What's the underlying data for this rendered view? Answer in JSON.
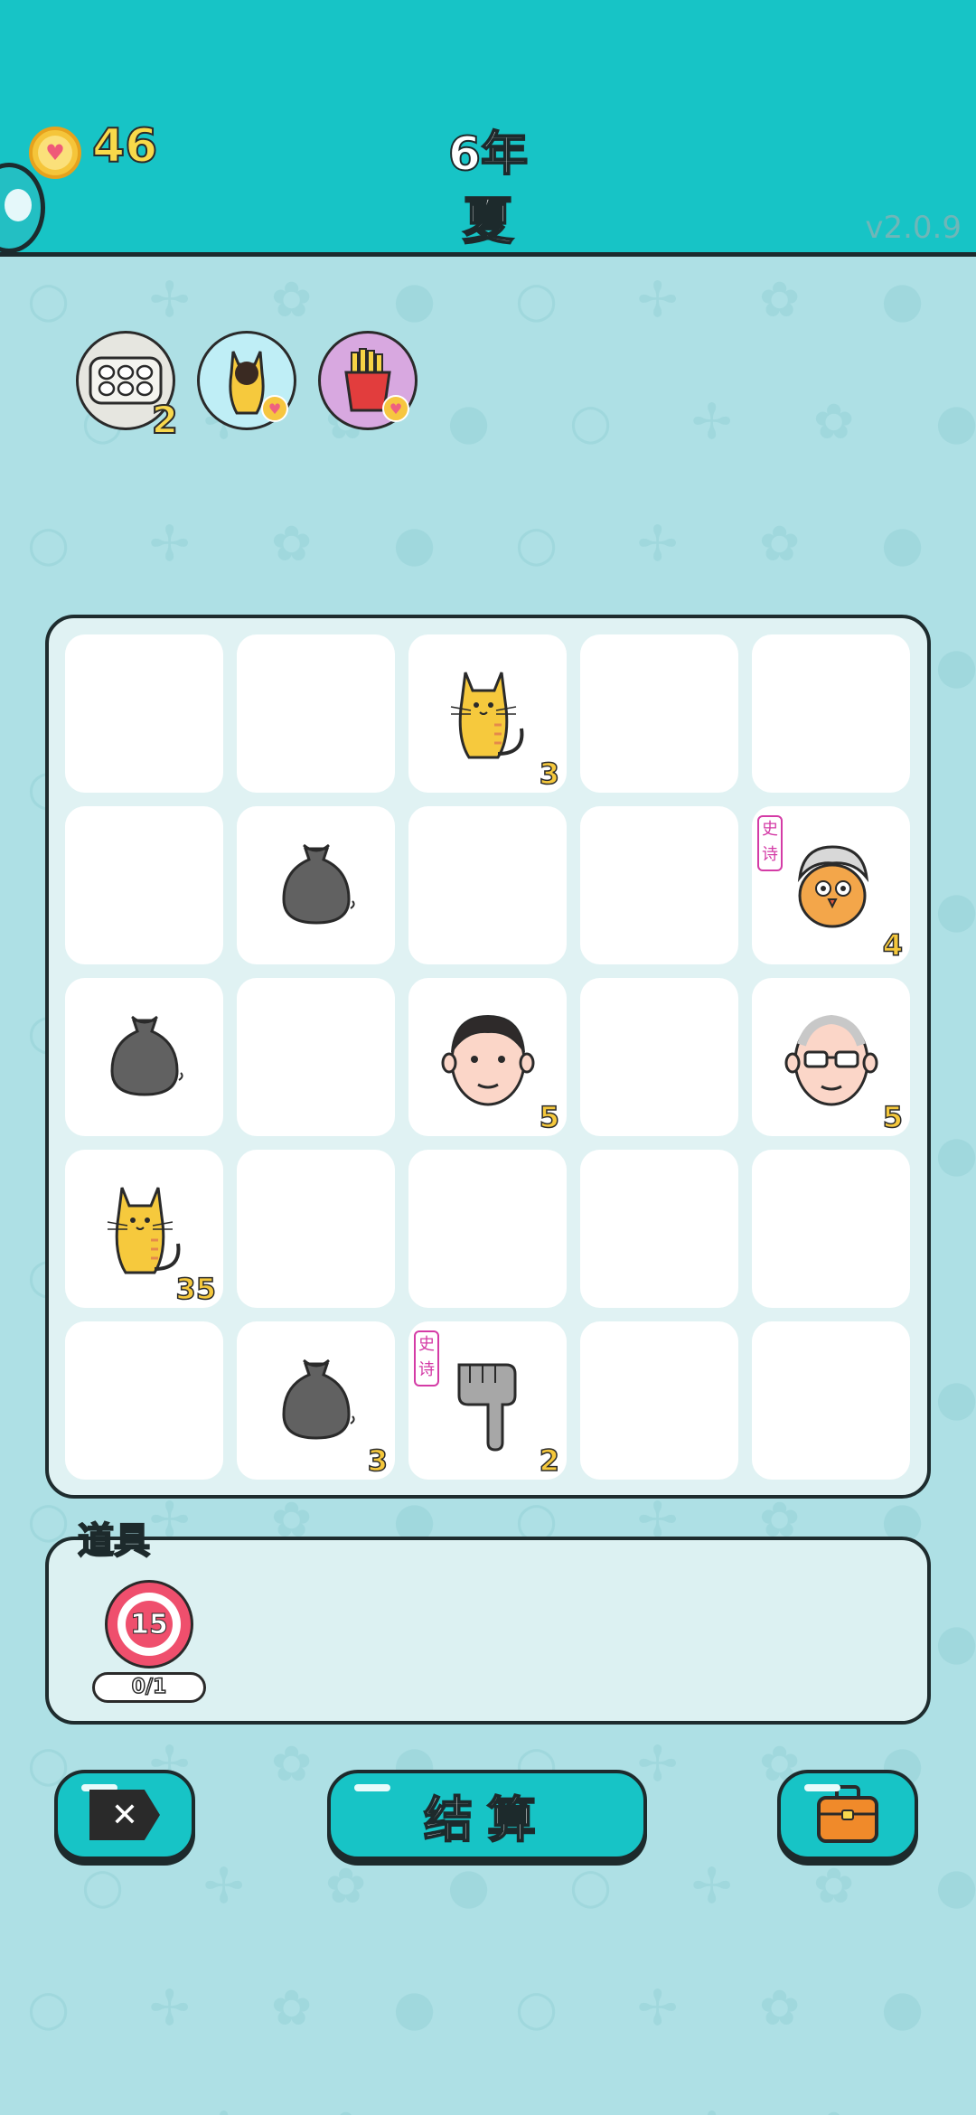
{
  "header": {
    "coins": "46",
    "year": "6年",
    "season": "夏",
    "version": "v2.0.9"
  },
  "inventory": [
    {
      "icon": "egg-tray-icon",
      "count": "2",
      "bg": "#e6e6e0"
    },
    {
      "icon": "cat-icon",
      "count": "",
      "bg": "#bfeef6"
    },
    {
      "icon": "fries-icon",
      "count": "",
      "bg": "#d8a8e0"
    }
  ],
  "board": {
    "rows": [
      [
        {
          "item": "",
          "count": ""
        },
        {
          "item": "",
          "count": ""
        },
        {
          "item": "cat",
          "count": "3"
        },
        {
          "item": "",
          "count": ""
        },
        {
          "item": "",
          "count": ""
        }
      ],
      [
        {
          "item": "",
          "count": ""
        },
        {
          "item": "garbage-bag",
          "count": ""
        },
        {
          "item": "",
          "count": ""
        },
        {
          "item": "",
          "count": ""
        },
        {
          "item": "chick-grandma",
          "count": "4",
          "epic": "史诗"
        }
      ],
      [
        {
          "item": "garbage-bag",
          "count": ""
        },
        {
          "item": "",
          "count": ""
        },
        {
          "item": "man-face",
          "count": "5"
        },
        {
          "item": "",
          "count": ""
        },
        {
          "item": "old-man-face",
          "count": "5"
        }
      ],
      [
        {
          "item": "cat",
          "count": "35"
        },
        {
          "item": "",
          "count": ""
        },
        {
          "item": "",
          "count": ""
        },
        {
          "item": "",
          "count": ""
        },
        {
          "item": "",
          "count": ""
        }
      ],
      [
        {
          "item": "",
          "count": ""
        },
        {
          "item": "garbage-bag",
          "count": "3"
        },
        {
          "item": "pointing-hand",
          "count": "2",
          "epic": "史诗"
        },
        {
          "item": "",
          "count": ""
        },
        {
          "item": "",
          "count": ""
        }
      ]
    ]
  },
  "props": {
    "title": "道具",
    "target_number": "15",
    "progress": "0/1"
  },
  "buttons": {
    "close_icon": "close-icon",
    "settle_label": "结算",
    "bag_icon": "briefcase-icon"
  },
  "colors": {
    "accent": "#17c4c6",
    "background": "#aee0e5",
    "count_yellow": "#f5c83c",
    "epic_magenta": "#d43ba6"
  }
}
